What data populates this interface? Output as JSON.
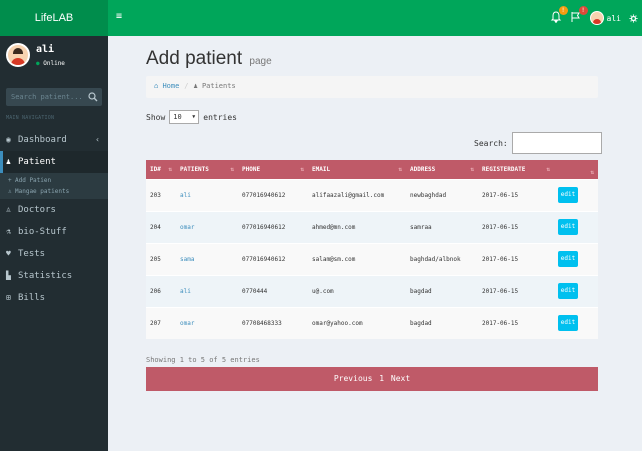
{
  "app": {
    "logo": "LifeLAB",
    "menu_icon": "≡"
  },
  "topbar": {
    "notif_badge": "!",
    "flag_badge": "!",
    "user_name": "ali",
    "gear_icon": "gear-icon"
  },
  "sidebar": {
    "user_name": "ali",
    "status": "Online",
    "search_placeholder": "Search patient...",
    "nav_header": "MAIN NAVIGATION",
    "items": [
      {
        "label": "Dashboard",
        "icon": "dashboard-icon"
      },
      {
        "label": "Patient",
        "icon": "users-icon"
      },
      {
        "label": "Doctors",
        "icon": "user-md-icon"
      },
      {
        "label": "bio-Stuff",
        "icon": "flask-icon"
      },
      {
        "label": "Tests",
        "icon": "heartbeat-icon"
      },
      {
        "label": "Statistics",
        "icon": "chart-icon"
      },
      {
        "label": "Bills",
        "icon": "cart-icon"
      }
    ],
    "sub_items": [
      {
        "label": "Add Patien"
      },
      {
        "label": "Mangae patients"
      }
    ]
  },
  "page": {
    "title": "Add patient",
    "subtitle": "page",
    "breadcrumb_home": "Home",
    "breadcrumb_current": "Patients"
  },
  "table_ctrl": {
    "show_label": "Show",
    "page_size": "10",
    "entries_label": "entries",
    "search_label": "Search:",
    "search_value": ""
  },
  "table": {
    "headers": [
      "ID#",
      "PATIENTS",
      "PHONE",
      "EMAIL",
      "ADDRESS",
      "REGISTERDATE",
      ""
    ],
    "rows": [
      {
        "id": "203",
        "patient": "ali",
        "phone": "077016940612",
        "email": "alifaazali@gmail.com",
        "address": "newbaghdad",
        "date": "2017-06-15",
        "action": "edit"
      },
      {
        "id": "204",
        "patient": "omar",
        "phone": "077016940612",
        "email": "ahmed@mn.com",
        "address": "samraa",
        "date": "2017-06-15",
        "action": "edit"
      },
      {
        "id": "205",
        "patient": "sama",
        "phone": "077016940612",
        "email": "salam@sm.com",
        "address": "baghdad/albnok",
        "date": "2017-06-15",
        "action": "edit"
      },
      {
        "id": "206",
        "patient": "ali",
        "phone": "0770444",
        "email": "u@.com",
        "address": "bagdad",
        "date": "2017-06-15",
        "action": "edit"
      },
      {
        "id": "207",
        "patient": "omar",
        "phone": "07708468333",
        "email": "omar@yahoo.com",
        "address": "bagdad",
        "date": "2017-06-15",
        "action": "edit"
      }
    ],
    "info": "Showing 1 to 5 of 5 entries",
    "pager_prev": "Previous",
    "pager_page": "1",
    "pager_next": "Next"
  },
  "colors": {
    "topbar": "#00a65a",
    "logo_bg": "#008d4c",
    "sidebar": "#222d32",
    "table_header": "#bf5a68",
    "edit_button": "#00c0ef",
    "link": "#3c8dbc"
  }
}
